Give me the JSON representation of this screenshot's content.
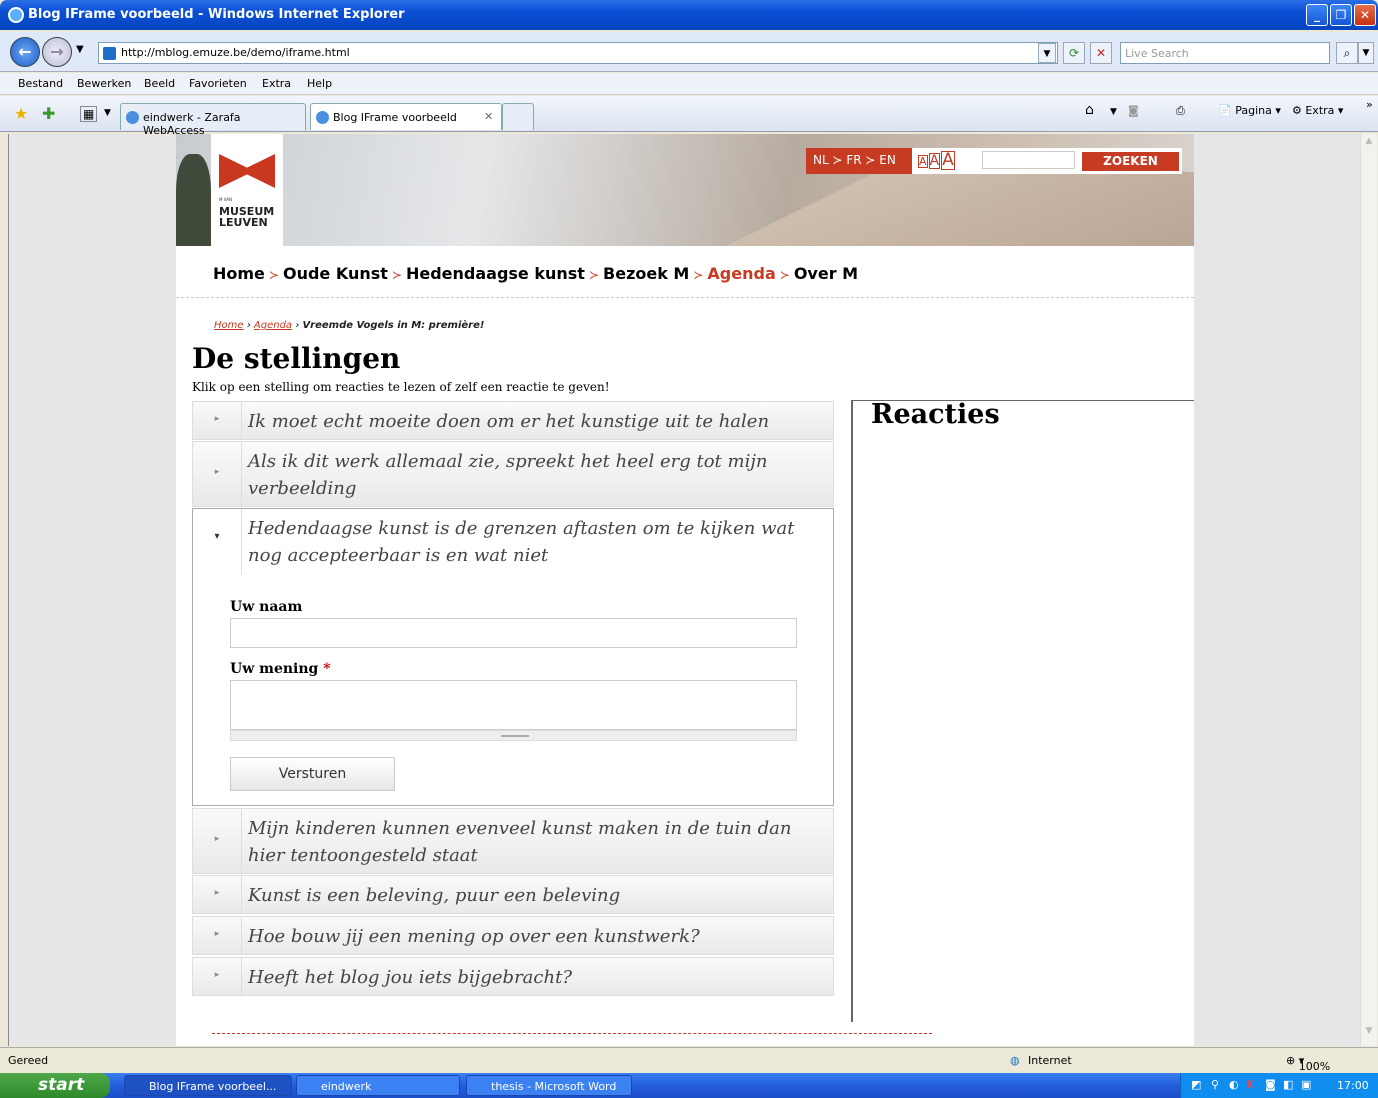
{
  "window": {
    "title": "Blog IFrame voorbeeld - Windows Internet Explorer"
  },
  "address": {
    "url": "http://mblog.emuze.be/demo/iframe.html",
    "search_placeholder": "Live Search"
  },
  "menu": [
    "Bestand",
    "Bewerken",
    "Beeld",
    "Favorieten",
    "Extra",
    "Help"
  ],
  "tabs": [
    {
      "label": "eindwerk - Zarafa WebAccess"
    },
    {
      "label": "Blog IFrame voorbeeld"
    }
  ],
  "command_bar": {
    "page": "Pagina",
    "tools": "Extra"
  },
  "site": {
    "logo_small": "M VAN",
    "logo_name_1": "MUSEUM",
    "logo_name_2": "LEUVEN",
    "lang": "NL ≻ FR ≻ EN",
    "fontsizes": [
      "A",
      "A",
      "A"
    ],
    "search_button": "ZOEKEN",
    "nav": [
      "Home",
      "Oude Kunst",
      "Hedendaagse kunst",
      "Bezoek M",
      "Agenda",
      "Over M"
    ],
    "nav_sep": "≻",
    "breadcrumb": {
      "home": "Home",
      "agenda": "Agenda",
      "current": "Vreemde Vogels in M: première!",
      "sep": "›"
    }
  },
  "content": {
    "title": "De stellingen",
    "subtitle": "Klik op een stelling om reacties te lezen of zelf een reactie te geven!",
    "statements": [
      "Ik moet echt moeite doen om er het kunstige uit te halen",
      "Als ik dit werk allemaal zie, spreekt het heel erg tot mijn verbeelding",
      "Hedendaagse kunst is de grenzen aftasten om te kijken wat nog accepteerbaar is en wat niet",
      "Mijn kinderen kunnen evenveel kunst maken in de tuin dan hier tentoongesteld staat",
      "Kunst is een beleving, puur een beleving",
      "Hoe bouw jij een mening op over een kunstwerk?",
      "Heeft het blog jou iets bijgebracht?"
    ],
    "form": {
      "name_label": "Uw naam",
      "opinion_label": "Uw mening",
      "required_mark": "*",
      "submit": "Versturen"
    },
    "reacties_title": "Reacties"
  },
  "status": {
    "text": "Gereed",
    "zone": "Internet",
    "zoom": "100%"
  },
  "taskbar": {
    "start": "start",
    "tasks": [
      "Blog IFrame voorbeel...",
      "eindwerk",
      "thesis - Microsoft Word"
    ],
    "time": "17:00"
  }
}
